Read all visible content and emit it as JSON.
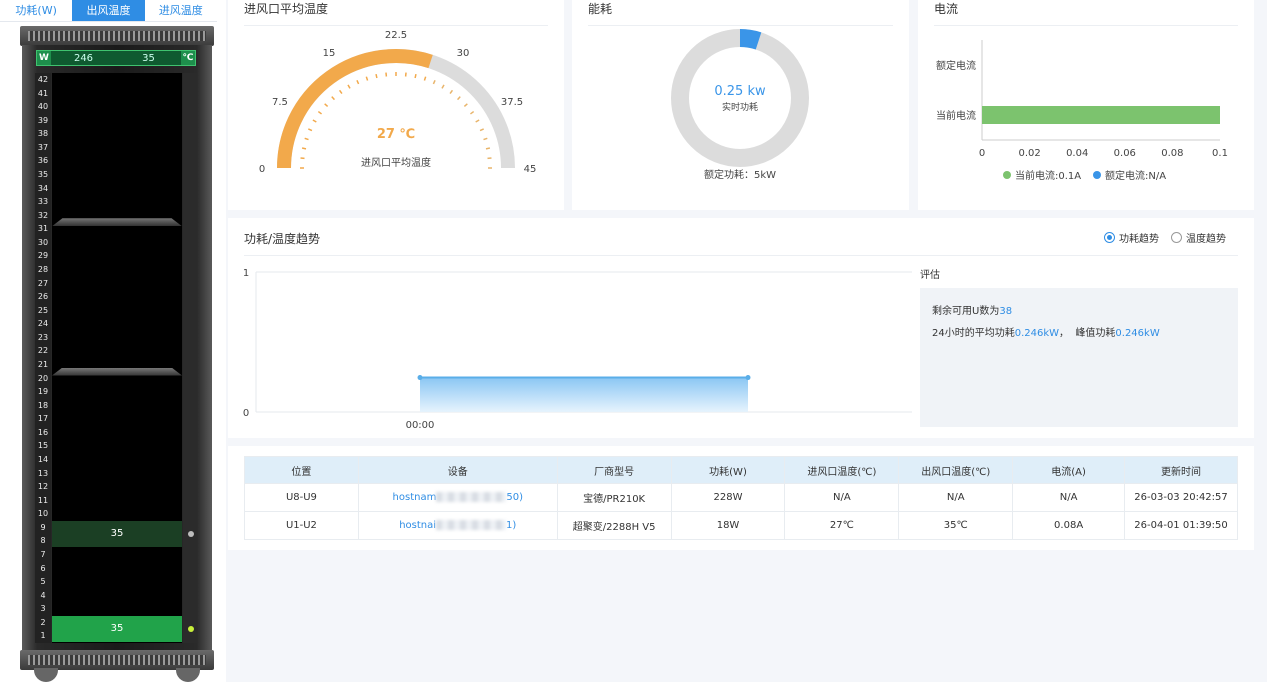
{
  "tabs": [
    {
      "label": "功耗(W)",
      "active": false
    },
    {
      "label": "出风温度",
      "active": true
    },
    {
      "label": "进风温度",
      "active": false
    }
  ],
  "rack": {
    "readout_left_cap": "W",
    "readout_left_value": "246",
    "readout_right_value": "35",
    "readout_right_cap": "℃",
    "units": [
      "42",
      "41",
      "40",
      "39",
      "38",
      "37",
      "36",
      "35",
      "34",
      "33",
      "32",
      "31",
      "30",
      "29",
      "28",
      "27",
      "26",
      "25",
      "24",
      "23",
      "22",
      "21",
      "20",
      "19",
      "18",
      "17",
      "16",
      "15",
      "14",
      "13",
      "12",
      "11",
      "10",
      "9",
      "8",
      "7",
      "6",
      "5",
      "4",
      "3",
      "2",
      "1"
    ],
    "devices": [
      {
        "label": "35",
        "top_u": 9,
        "height_u": 2,
        "color": "#1b3f24",
        "led": "#bdbdbd"
      },
      {
        "label": "35",
        "top_u": 2,
        "height_u": 2,
        "color": "#21a34a",
        "led": "#c8f03a"
      }
    ],
    "shelves_after_u": [
      32,
      21
    ]
  },
  "gauge": {
    "title": "进风口平均温度",
    "value_text": "27 ℃",
    "caption": "进风口平均温度",
    "value": 27,
    "min": 0,
    "max": 45,
    "ticks": [
      "0",
      "7.5",
      "15",
      "22.5",
      "30",
      "37.5",
      "45"
    ],
    "color": "#f2a94b",
    "track_color": "#dcdcdc"
  },
  "energy": {
    "title": "能耗",
    "value_text": "0.25 kw",
    "sub_text": "实时功耗",
    "rated_text": "额定功耗：5kW",
    "fraction": 0.05,
    "color": "#3a95e8",
    "track_color": "#dcdcdc"
  },
  "current_chart": {
    "title": "电流",
    "chart_data": {
      "type": "bar",
      "orientation": "horizontal",
      "categories": [
        "额定电流",
        "当前电流"
      ],
      "values": [
        null,
        0.1
      ],
      "x_ticks": [
        "0",
        "0.02",
        "0.04",
        "0.06",
        "0.08",
        "0.1"
      ],
      "xlim": [
        0,
        0.1
      ],
      "colors": [
        "#3a95e8",
        "#7cc36e"
      ]
    },
    "legend": [
      {
        "label": "当前电流:0.1A",
        "color": "#7cc36e"
      },
      {
        "label": "额定电流:N/A",
        "color": "#3a95e8"
      }
    ]
  },
  "trend": {
    "title": "功耗/温度趋势",
    "radio_power": "功耗趋势",
    "radio_temp": "温度趋势",
    "selected": "power",
    "chart_data": {
      "type": "area",
      "x": [
        "00:00"
      ],
      "series": [
        {
          "values": [
            0.246,
            0.246
          ]
        }
      ],
      "ylim": [
        0,
        1
      ],
      "y_ticks": [
        "1",
        "0"
      ],
      "x_ticks": [
        "00:00"
      ]
    },
    "assess_title": "评估",
    "remaining_prefix": "剩余可用U数为",
    "remaining_value": "38",
    "avg_prefix": "24小时的平均功耗",
    "avg_value": "0.246kW",
    "peak_sep": "，  峰值功耗",
    "peak_value": "0.246kW"
  },
  "table": {
    "headers": [
      "位置",
      "设备",
      "厂商型号",
      "功耗(W)",
      "进风口温度(℃)",
      "出风口温度(℃)",
      "电流(A)",
      "更新时间"
    ],
    "rows": [
      {
        "pos": "U8-U9",
        "dev_prefix": "hostnam",
        "dev_suffix": "50)",
        "model": "宝德/PR210K",
        "power": "228W",
        "in_temp": "N/A",
        "out_temp": "N/A",
        "current": "N/A",
        "time": "26-03-03 20:42:57"
      },
      {
        "pos": "U1-U2",
        "dev_prefix": "hostnai",
        "dev_suffix": "1)",
        "model": "超聚变/2288H V5",
        "power": "18W",
        "in_temp": "27℃",
        "out_temp": "35℃",
        "current": "0.08A",
        "time": "26-04-01 01:39:50"
      }
    ]
  }
}
